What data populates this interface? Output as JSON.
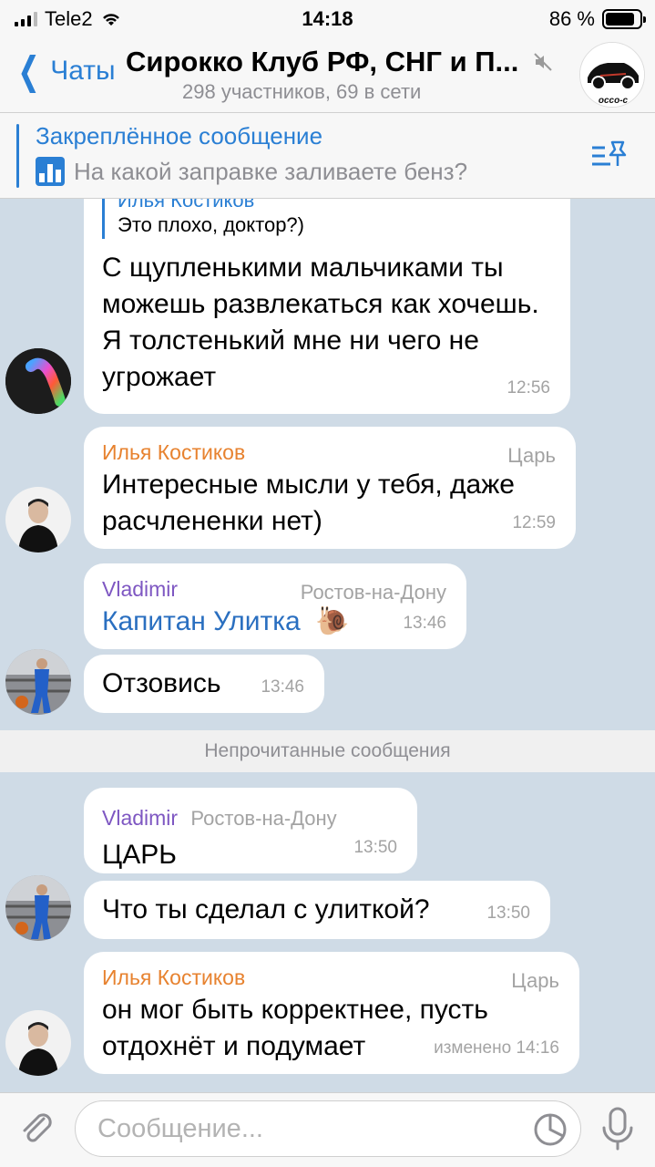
{
  "status": {
    "carrier": "Tele2",
    "time": "14:18",
    "battery": "86 %",
    "battery_level": 0.86
  },
  "header": {
    "back_label": "Чаты",
    "title": "Сирокко Клуб РФ, СНГ и П...",
    "subtitle": "298 участников, 69 в сети",
    "avatar_text": "occo-c"
  },
  "pinned": {
    "title": "Закреплённое сообщение",
    "text": "На какой заправке заливаете бенз?"
  },
  "messages": [
    {
      "reply_name": "Илья Костиков",
      "reply_text": "Это плохо, доктор?)",
      "text": "С щупленькими мальчиками ты можешь развлекаться как хочешь. Я толстенький мне ни чего не угрожает",
      "time": "12:56"
    },
    {
      "sender": "Илья Костиков",
      "role": "Царь",
      "text": "Интересные мысли у тебя, даже расчлененки нет)",
      "time": "12:59"
    },
    {
      "sender": "Vladimir",
      "role": "Ростов-на-Дону",
      "text": "Капитан Улитка",
      "time": "13:46"
    },
    {
      "text": "Отзовись",
      "time": "13:46"
    },
    {
      "sender": "Vladimir",
      "role": "Ростов-на-Дону",
      "text": "ЦАРЬ",
      "time": "13:50"
    },
    {
      "text": "Что ты сделал с улиткой?",
      "time": "13:50"
    },
    {
      "sender": "Илья Костиков",
      "role": "Царь",
      "text": "он мог быть корректнее, пусть отдохнёт и подумает",
      "time": "изменено 14:16"
    }
  ],
  "unread_label": "Непрочитанные сообщения",
  "input": {
    "placeholder": "Сообщение..."
  },
  "colors": {
    "accent": "#2a7fd4",
    "orange_name": "#e7822f",
    "violet_name": "#7e57c2",
    "chat_bg": "#cfdbe6"
  },
  "icons": [
    "signal-icon",
    "wifi-icon",
    "battery-icon",
    "back-chevron-icon",
    "mute-icon",
    "pinned-list-icon",
    "poll-icon",
    "snail-emoji",
    "attach-icon",
    "sticker-icon",
    "mic-icon"
  ]
}
